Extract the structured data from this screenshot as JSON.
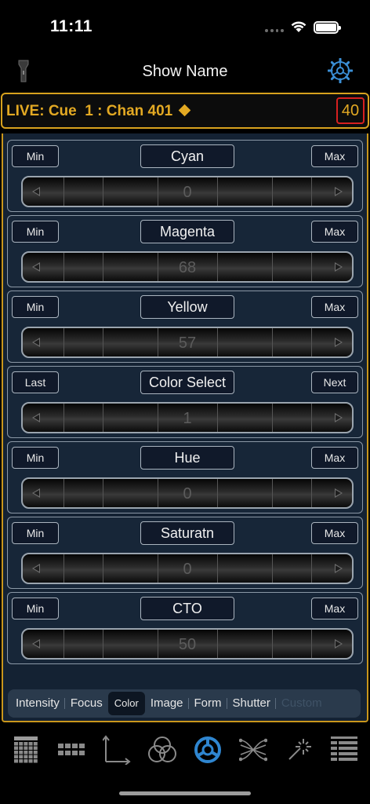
{
  "status_bar": {
    "time": "11:11"
  },
  "header": {
    "title": "Show Name",
    "left_icon": "flashlight-icon",
    "right_icon": "gear-icon"
  },
  "live": {
    "text": "LIVE: Cue  1 : Chan 401",
    "level": "40",
    "accent": "#e3a923"
  },
  "params": [
    {
      "left": "Min",
      "name": "Cyan",
      "right": "Max",
      "value": "0"
    },
    {
      "left": "Min",
      "name": "Magenta",
      "right": "Max",
      "value": "68"
    },
    {
      "left": "Min",
      "name": "Yellow",
      "right": "Max",
      "value": "57"
    },
    {
      "left": "Last",
      "name": "Color Select",
      "right": "Next",
      "value": "1"
    },
    {
      "left": "Min",
      "name": "Hue",
      "right": "Max",
      "value": "0"
    },
    {
      "left": "Min",
      "name": "Saturatn",
      "right": "Max",
      "value": "0"
    },
    {
      "left": "Min",
      "name": "CTO",
      "right": "Max",
      "value": "50"
    }
  ],
  "tabs": [
    {
      "label": "Intensity"
    },
    {
      "label": "Focus"
    },
    {
      "label": "Color",
      "active": true
    },
    {
      "label": "Image"
    },
    {
      "label": "Form"
    },
    {
      "label": "Shutter"
    },
    {
      "label": "Custom",
      "disabled": true
    }
  ],
  "toolbar": [
    "channel-grid-icon",
    "keypad-icon",
    "axis-icon",
    "color-circles-icon",
    "color-wheel-icon",
    "crossfade-icon",
    "magic-wand-icon",
    "list-icon"
  ]
}
